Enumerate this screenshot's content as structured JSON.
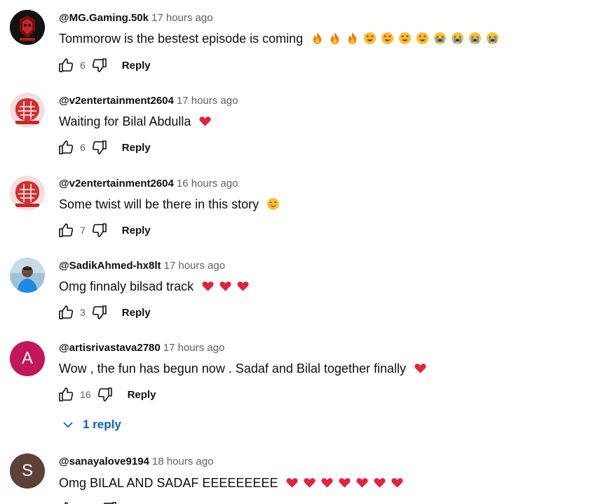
{
  "colors": {
    "link": "#065fd4",
    "secondary_text": "#606060",
    "heart": "#e0243a",
    "avatar_a": "#c2185b",
    "avatar_s": "#5d4037"
  },
  "comments": [
    {
      "author": "@MG.Gaming.50k",
      "time": "17 hours ago",
      "text": "Tommorow is the bestest episode is coming",
      "emojis": [
        "fire",
        "fire",
        "fire",
        "heart-eyes",
        "heart-eyes",
        "heart-eyes",
        "heart-eyes",
        "crying",
        "crying",
        "crying",
        "crying"
      ],
      "likes": "6",
      "reply_label": "Reply",
      "avatar": "dark-gaming-logo"
    },
    {
      "author": "@v2entertainment2604",
      "time": "17 hours ago",
      "text": "Waiting for Bilal Abdulla",
      "emojis": [
        "red-heart"
      ],
      "likes": "6",
      "reply_label": "Reply",
      "avatar": "red-pattern-logo"
    },
    {
      "author": "@v2entertainment2604",
      "time": "16 hours ago",
      "text": "Some twist will be there in this story",
      "emojis": [
        "smiling-face"
      ],
      "likes": "7",
      "reply_label": "Reply",
      "avatar": "red-pattern-logo"
    },
    {
      "author": "@SadikAhmed-hx8lt",
      "time": "17 hours ago",
      "text": "Omg finnaly bilsad track",
      "emojis": [
        "red-heart",
        "red-heart",
        "red-heart"
      ],
      "likes": "3",
      "reply_label": "Reply",
      "avatar": "person-photo"
    },
    {
      "author": "@artisrivastava2780",
      "time": "17 hours ago",
      "text": "Wow , the fun has begun now . Sadaf and Bilal together finally",
      "emojis": [
        "red-heart"
      ],
      "likes": "16",
      "reply_label": "Reply",
      "avatar_letter": "A",
      "replies_label": "1 reply"
    },
    {
      "author": "@sanayalove9194",
      "time": "18 hours ago",
      "text": "Omg BILAL AND SADAF EEEEEEEEE",
      "emojis": [
        "red-heart",
        "red-heart",
        "red-heart",
        "red-heart",
        "red-heart",
        "red-heart",
        "red-heart"
      ],
      "avatar_letter": "S"
    }
  ]
}
